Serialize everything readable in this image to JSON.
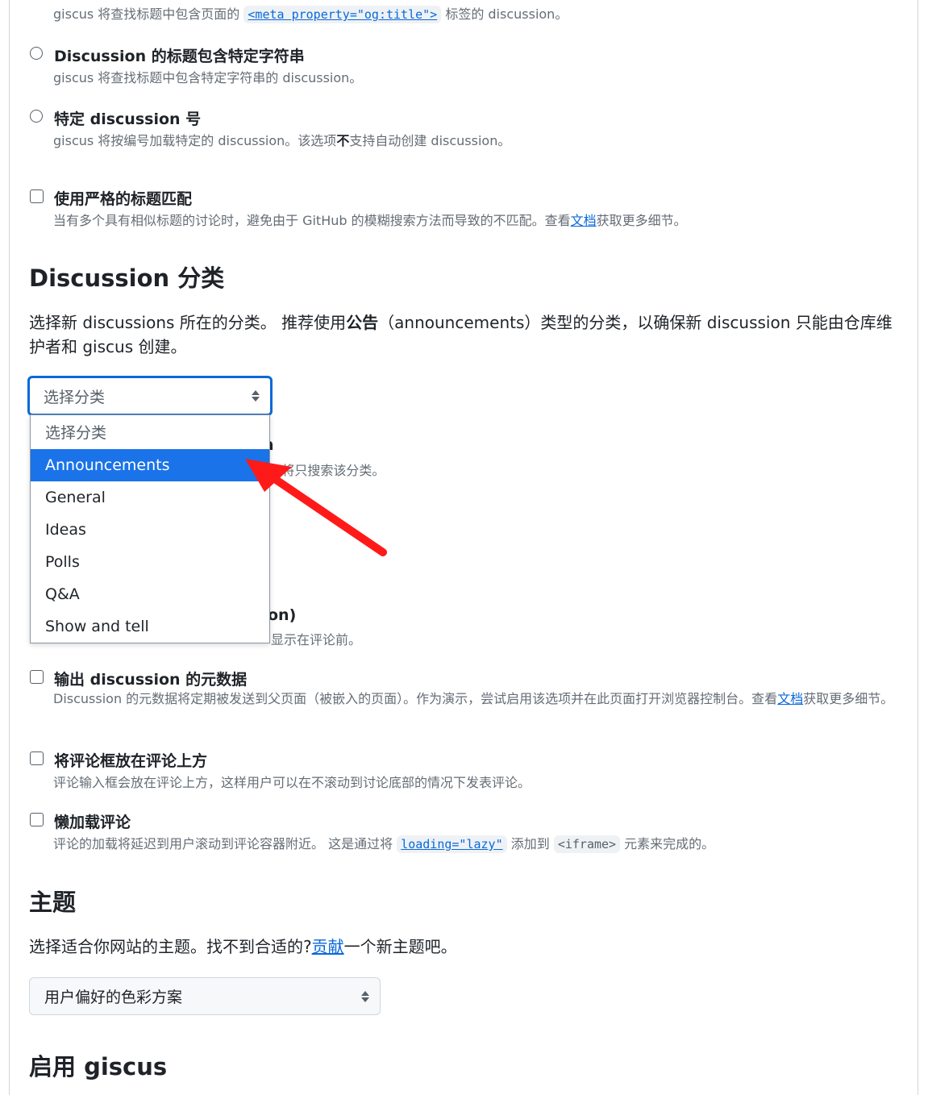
{
  "mapping": {
    "og_title_desc_pre": "giscus 将查找标题中包含页面的",
    "og_title_code": "<meta property=\"og:title\">",
    "og_title_desc_post": "标签的 discussion。",
    "options": [
      {
        "label": "Discussion 的标题包含特定字符串",
        "desc": "giscus 将查找标题中包含特定字符串的 discussion。"
      },
      {
        "label": "特定 discussion 号",
        "desc_pre": "giscus 将按编号加载特定的 discussion。该选项",
        "desc_bold": "不",
        "desc_post": "支持自动创建 discussion。"
      }
    ],
    "strict": {
      "label": "使用严格的标题匹配",
      "desc_pre": "当有多个具有相似标题的讨论时，避免由于 GitHub 的模糊搜索方法而导致的不匹配。查看",
      "desc_link": "文档",
      "desc_post": "获取更多细节。"
    }
  },
  "category": {
    "heading": "Discussion 分类",
    "desc_pre": "选择新 discussions 所在的分类。 推荐使用",
    "desc_bold": "公告",
    "desc_post": "（announcements）类型的分类，以确保新 discussion 只能由仓库维护者和 giscus 创建。",
    "select_placeholder": "选择分类",
    "options": [
      "选择分类",
      "Announcements",
      "General",
      "Ideas",
      "Polls",
      "Q&A",
      "Show and tell"
    ],
    "selected_index": 1,
    "peek_1": "n",
    "peek_2": "s 将只搜索该分类。",
    "peek_3": "on)",
    "peek_4": "显示在评论前。"
  },
  "features": {
    "metadata": {
      "label": "输出 discussion 的元数据",
      "desc_pre": "Discussion 的元数据将定期被发送到父页面（被嵌入的页面）。作为演示，尝试启用该选项并在此页面打开浏览器控制台。查看",
      "desc_link": "文档",
      "desc_post": "获取更多细节。"
    },
    "input_top": {
      "label": "将评论框放在评论上方",
      "desc": "评论输入框会放在评论上方，这样用户可以在不滚动到讨论底部的情况下发表评论。"
    },
    "lazy": {
      "label": "懒加载评论",
      "desc_pre": "评论的加载将延迟到用户滚动到评论容器附近。 这是通过将",
      "code1": "loading=\"lazy\"",
      "desc_mid": "添加到",
      "code2": "<iframe>",
      "desc_post": "元素来完成的。"
    }
  },
  "theme": {
    "heading": "主题",
    "desc_pre": "选择适合你网站的主题。找不到合适的?",
    "desc_link": "贡献",
    "desc_post": "一个新主题吧。",
    "select_value": "用户偏好的色彩方案"
  },
  "enable": {
    "heading": "启用 giscus"
  },
  "colors": {
    "accent": "#0969da",
    "highlight": "#1a73e8",
    "arrow": "#ff1a1a"
  }
}
